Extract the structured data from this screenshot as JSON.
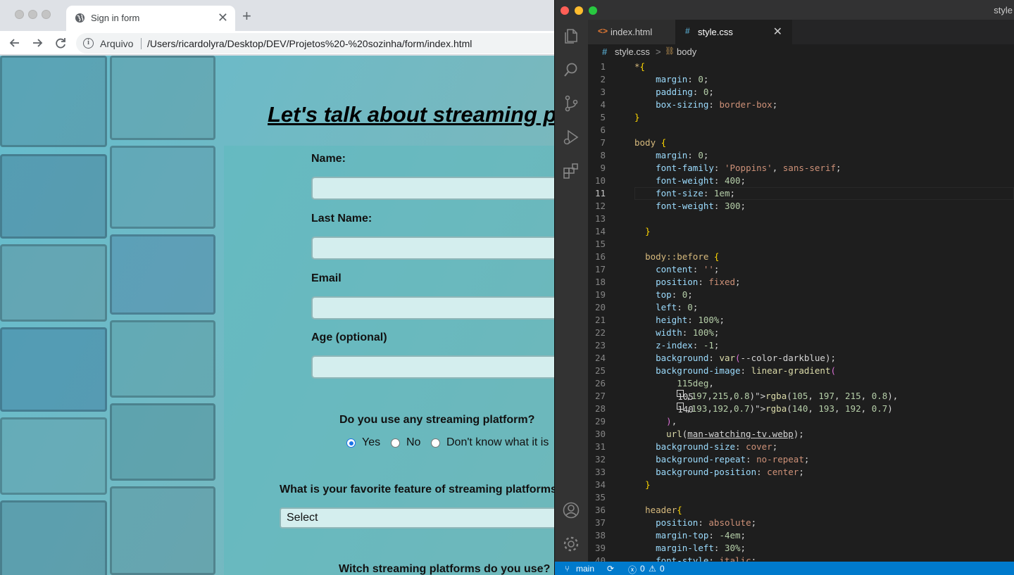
{
  "browser": {
    "tab_title": "Sign in form",
    "new_tab_glyph": "+",
    "close_glyph": "✕",
    "address_label": "Arquivo",
    "url": "/Users/ricardolyra/Desktop/DEV/Projetos%20-%20sozinha/form/index.html",
    "icons": [
      "back-arrow-icon",
      "forward-arrow-icon",
      "reload-icon",
      "info-icon",
      "globe-icon"
    ]
  },
  "page": {
    "heading": "Let's talk about streaming p",
    "fields": [
      {
        "label": "Name:",
        "value": ""
      },
      {
        "label": "Last Name:",
        "value": ""
      },
      {
        "label": "Email",
        "value": ""
      },
      {
        "label": "Age (optional)",
        "value": ""
      }
    ],
    "streaming_question": "Do you use any streaming platform?",
    "radio_options": [
      {
        "label": "Yes",
        "checked": true
      },
      {
        "label": "No",
        "checked": false
      },
      {
        "label": "Don't know what it is",
        "checked": false
      }
    ],
    "feature_question": "What is your favorite feature of streaming platforms",
    "feature_select": "Select",
    "platforms_question": "Witch streaming platforms do you use?"
  },
  "vscode": {
    "window_title": "style",
    "tabs": [
      {
        "icon": "<>",
        "label": "index.html",
        "active": false
      },
      {
        "icon": "#",
        "label": "style.css",
        "active": true
      }
    ],
    "breadcrumb": {
      "file": "style.css",
      "sep": ">",
      "symbol": "body"
    },
    "current_line": 11,
    "code_lines": [
      "*{",
      "    margin: 0;",
      "    padding: 0;",
      "    box-sizing: border-box;",
      "}",
      "",
      "body {",
      "    margin: 0;",
      "    font-family: 'Poppins', sans-serif;",
      "    font-weight: 400;",
      "    font-size: 1em;",
      "    font-weight: 300;",
      "",
      "  }",
      "",
      "  body::before {",
      "    content: '';",
      "    position: fixed;",
      "    top: 0;",
      "    left: 0;",
      "    height: 100%;",
      "    width: 100%;",
      "    z-index: -1;",
      "    background: var(--color-darkblue);",
      "    background-image: linear-gradient(",
      "        115deg,",
      "        rgba(105, 197, 215, 0.8),",
      "        rgba(140, 193, 192, 0.7)",
      "      ),",
      "      url(man-watching-tv.webp);",
      "    background-size: cover;",
      "    background-repeat: no-repeat;",
      "    background-position: center;",
      "  }",
      "",
      "  header{",
      "    position: absolute;",
      "    margin-top: -4em;",
      "    margin-left: 30%;",
      "    font-style: italic;"
    ],
    "status": {
      "branch": "main",
      "errors": "0",
      "warnings": "0"
    },
    "activity_icons": [
      "explorer-icon",
      "search-icon",
      "source-control-icon",
      "run-debug-icon",
      "extensions-icon",
      "account-icon",
      "settings-gear-icon"
    ]
  }
}
